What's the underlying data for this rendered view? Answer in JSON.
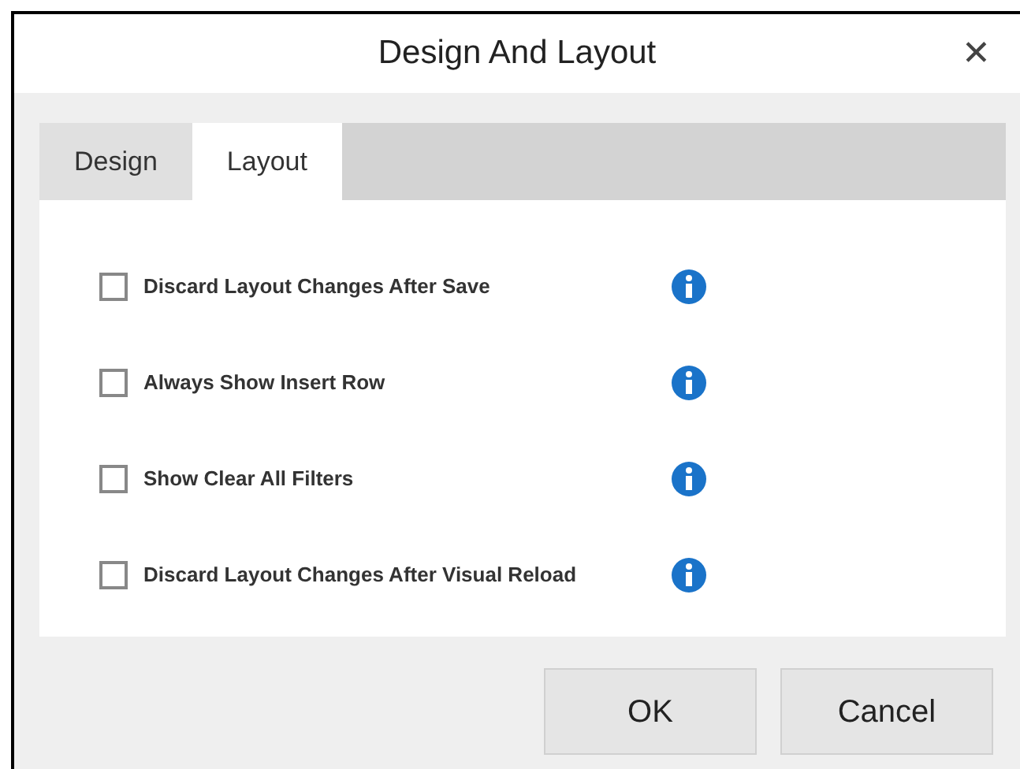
{
  "window": {
    "title": "Design And Layout",
    "close": "✕"
  },
  "tabs": [
    {
      "label": "Design",
      "selected": false
    },
    {
      "label": "Layout",
      "selected": true
    }
  ],
  "options": [
    {
      "label": "Discard Layout Changes After Save",
      "checked": false
    },
    {
      "label": "Always Show Insert Row",
      "checked": false
    },
    {
      "label": "Show Clear All Filters",
      "checked": false
    },
    {
      "label": "Discard Layout Changes After Visual Reload",
      "checked": false
    }
  ],
  "buttons": [
    "OK",
    "Cancel"
  ]
}
